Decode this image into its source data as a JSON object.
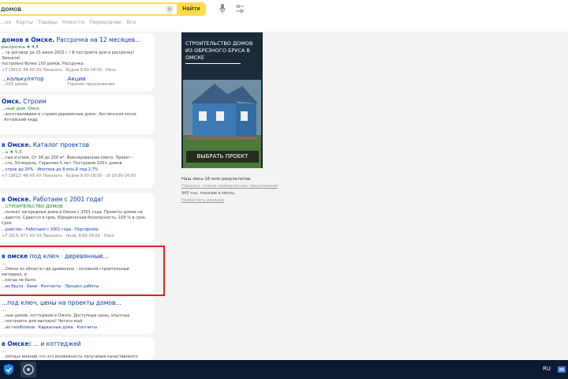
{
  "search": {
    "query": "домов",
    "button": "Найти"
  },
  "tabs": [
    "...ео",
    "Карты",
    "Товары",
    "Новости",
    "Переводчик",
    "Все"
  ],
  "results": [
    {
      "title_bold": "домов в Омске.",
      "title_rest": "Рассрочка на 12 месяцев...",
      "url": "рассрочка ★ 4,4",
      "text": "...те договор до 15 июня 2022 г.! И постройте дом в рассрочку! Звоните!",
      "text2": "построено более 100 домов. Рассрочка",
      "meta": "+7 (3812) 48-ХХ-ХХ Показать · Будни 9:00-18:00 · Омск",
      "sitelinks": [
        {
          "title": "...калькулятор",
          "sub": "...ХХХ домов"
        },
        {
          "title": "Акции",
          "sub": "Горячие предложения"
        }
      ]
    },
    {
      "title_bold": "Омск.",
      "title_rest": "Строим",
      "url": "...ный дом. Омск",
      "text": "...изготавливаем и строим деревянные дома · Англичская сосна.",
      "text2": "· Алтайский кедр"
    },
    {
      "title_bold": "в Омске.",
      "title_rest": "Каталог проектов",
      "url": "...ь ★ 5,0",
      "text": "...гые и кпиж. От 38 до 250 м². Фиксированная смета. Проект –",
      "text2": "...сть, 3d-модель. Гарантия 5 лет. Построили 100+ домов",
      "links": "...строк до 20% · Ипотека до 8 млн ₽ под 2,7%",
      "meta": "+7 (3812) 48-ХХ-ХХ Показать · Будни 9:00-18:00 · сб 10:00-14:00"
    },
    {
      "title_bold": "в Омске.",
      "title_rest": "Работаем с 2001 года!",
      "url": "...СТРОИТЕЛЬСТВО ДОМОВ",
      "text": "...полнит загородные дома в Омске с 2001 года. Проекты домов на",
      "text2": "...ваются. Сдаются в срок. Юридическая безопасность. 100 % в срок. Срок",
      "links": "...ройство · Работаем с 2001 года · Портфолио",
      "meta": "+7 (913) 971-ХХ-ХХ Показать · пн-вс 9:00-18:00 · Омск"
    },
    {
      "title_bold": "в омске",
      "title_rest": "под ключ · деревянные...",
      "url": "...",
      "text": "...Омске из области где древесина – основной строительный материал, и",
      "text2": "...когда не было.",
      "links": "...из бруса · Бани · Контакты · Процесс работы"
    },
    {
      "title_bold": "",
      "title_rest": "...под ключ, цены на проекты домов...",
      "url": "...",
      "text": "...ные домов, коттеджей в Омске. Доступные цены, опытные",
      "text2": "...постройте дом выгодно! Читать ещё",
      "links": "...из газоблоков · Каркасные дома · Контакты"
    },
    {
      "title_bold": "в Омске:",
      "title_rest": "... и коттеджей",
      "url": "...",
      "text": "...и коттеджей в Омске: 120...",
      "text2": "...оятных мнений что это возможность получения качественного"
    }
  ],
  "ad": {
    "headline": "СТРОИТЕЛЬСТВО ДОМОВ ИЗ ОБРЕЗНОГО БРУСА В ОМСКЕ",
    "cta": "ВЫБРАТЬ ПРОЕКТ",
    "desc": "Наш лось-16 млн результатов",
    "link1": "Показать только коммерческие предложения",
    "count": "943 тыс. показов в месяц",
    "link2": "Разместить рекламу"
  },
  "taskbar": {
    "lang": "RU"
  },
  "colors": {
    "accent": "#ffdb4d",
    "link": "#0c38a3",
    "url": "#0b7f2e",
    "highlight": "#e02020"
  }
}
